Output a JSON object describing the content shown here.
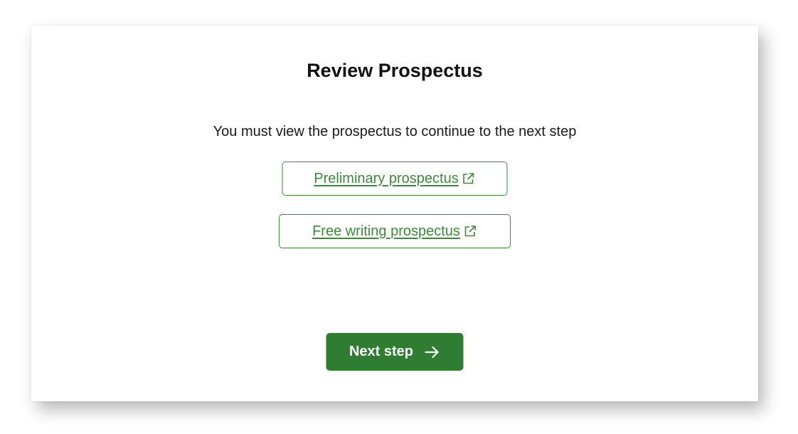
{
  "dialog": {
    "title": "Review Prospectus",
    "instruction": "You must view the prospectus to continue to the next step",
    "links": [
      {
        "label": "Preliminary prospectus",
        "icon": "external-link-icon"
      },
      {
        "label": "Free writing prospectus",
        "icon": "external-link-icon"
      }
    ],
    "next_button": {
      "label": "Next step",
      "icon": "arrow-right-icon"
    }
  },
  "colors": {
    "accent": "#3a8a3a",
    "primary_button": "#2f7d32",
    "text": "#111111",
    "background": "#ffffff"
  }
}
